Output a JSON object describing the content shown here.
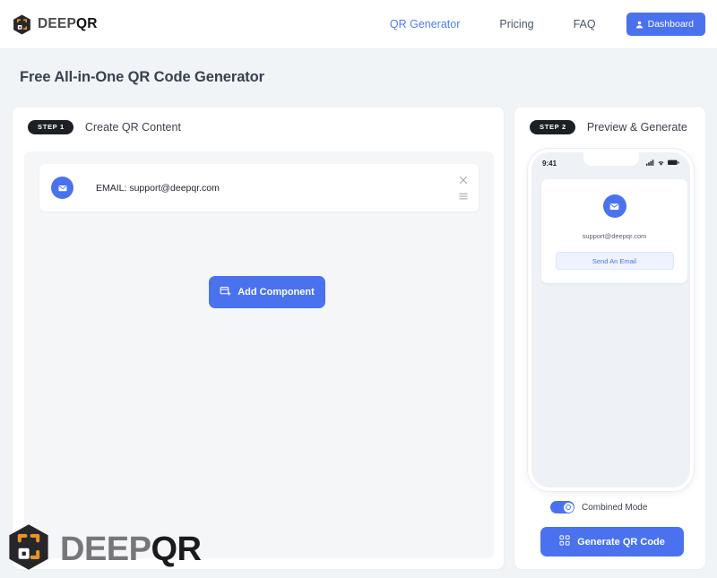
{
  "header": {
    "brand": {
      "deep": "DEEP",
      "qr": "QR",
      "icon": "hexagon-qr-logo-icon"
    },
    "nav": [
      {
        "label": "QR Generator",
        "active": true
      },
      {
        "label": "Pricing",
        "active": false
      },
      {
        "label": "FAQ",
        "active": false
      }
    ],
    "dashboard_button": {
      "label": "Dashboard",
      "icon": "user-icon",
      "color": "#4a72ef"
    }
  },
  "page_title": "Free All-in-One QR Code Generator",
  "left_panel": {
    "step_badge": "STEP 1",
    "title": "Create QR Content",
    "component": {
      "icon": "envelope-icon",
      "label": "EMAIL: support@deepqr.com",
      "close_icon": "close-icon",
      "drag_icon": "drag-handle-icon"
    },
    "add_button": {
      "label": "Add Component",
      "icon": "add-component-icon"
    }
  },
  "right_panel": {
    "step_badge": "STEP 2",
    "title": "Preview & Generate",
    "phone": {
      "status_time": "9:41",
      "status_icons": [
        "signal-icon",
        "wifi-icon",
        "battery-icon"
      ],
      "preview": {
        "icon": "envelope-icon",
        "email": "support@deepqr.com",
        "action_label": "Send An Email"
      }
    },
    "combined_mode": {
      "label": "Combined Mode",
      "enabled": true
    },
    "generate_button": {
      "label": "Generate QR Code",
      "icon": "qr-code-icon"
    }
  },
  "watermark": {
    "deep": "DEEP",
    "qr": "QR",
    "icon": "hexagon-qr-logo-icon"
  },
  "colors": {
    "accent_blue": "#4a72ef",
    "link_blue": "#4f7df3",
    "badge_dark": "#1c1f24",
    "logo_orange": "#e8922a",
    "page_bg": "#f1f4f7"
  }
}
